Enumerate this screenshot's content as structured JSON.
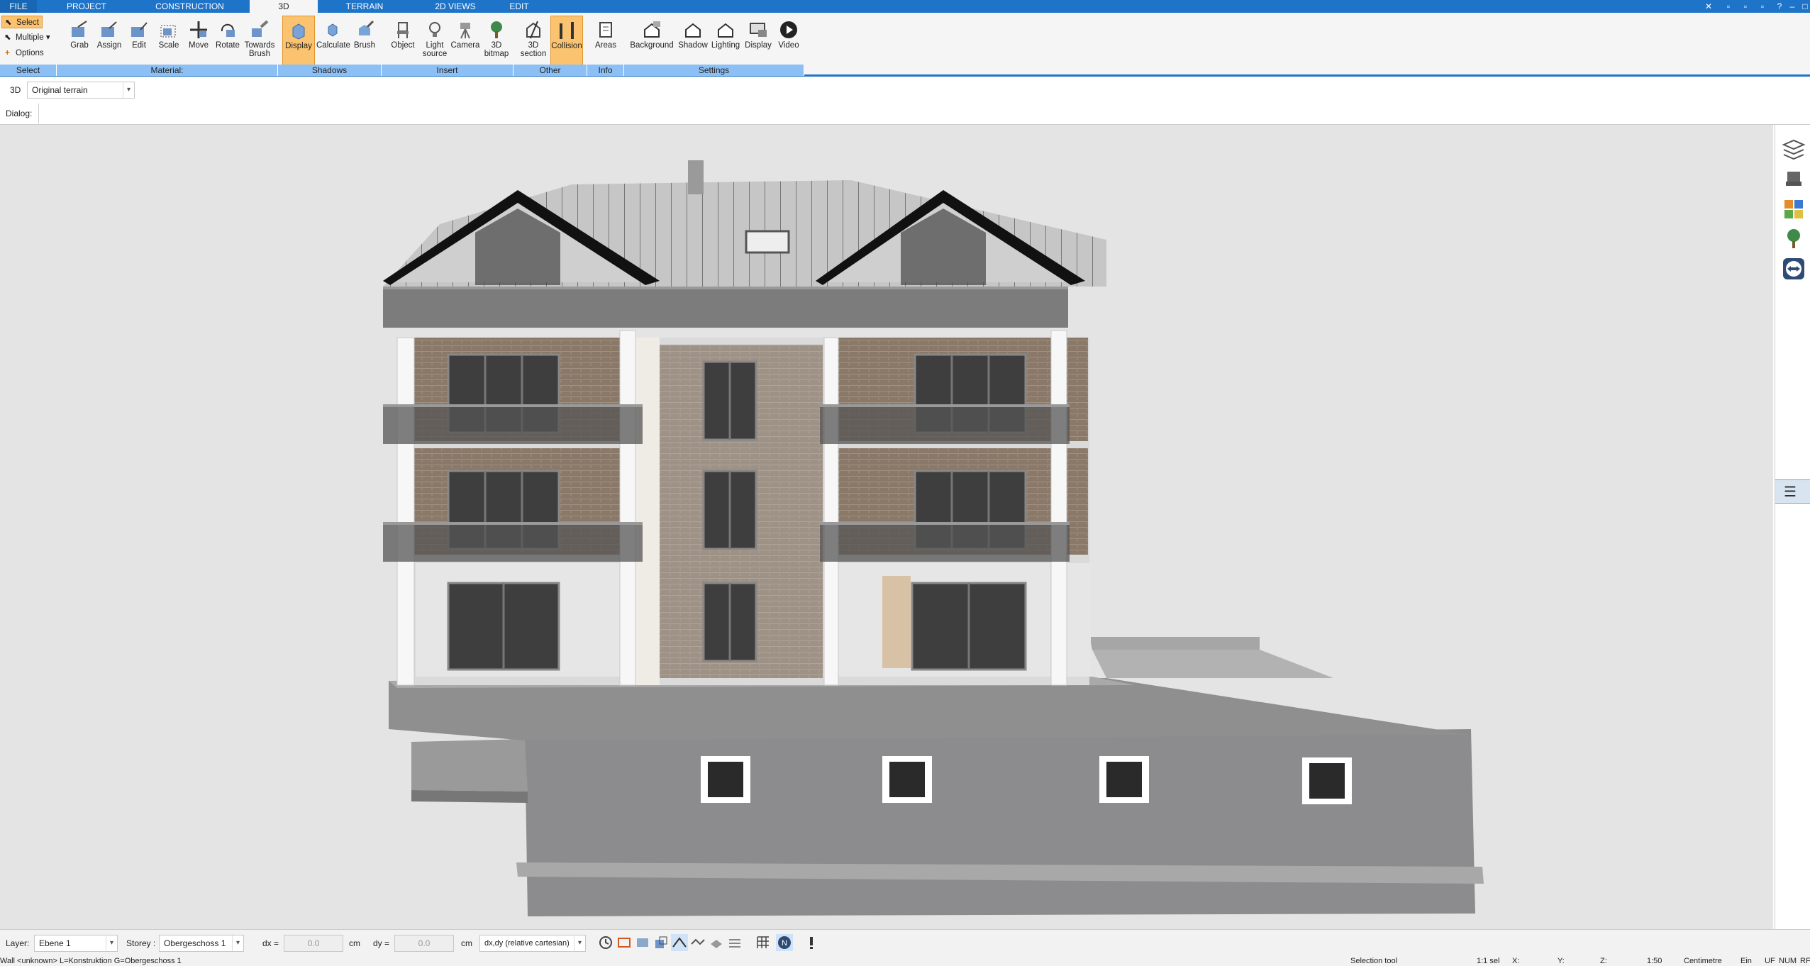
{
  "tabs": [
    "FILE",
    "PROJECT",
    "CONSTRUCTION",
    "3D",
    "TERRAIN",
    "2D VIEWS",
    "EDIT"
  ],
  "ribbon": {
    "select": {
      "select": "Select",
      "multiple": "Multiple",
      "options": "Options"
    },
    "buttons": [
      "Grab",
      "Assign",
      "Edit",
      "Scale",
      "Move",
      "Rotate",
      "Towards Brush",
      "Display",
      "Calculate",
      "Brush",
      "Object",
      "Light source",
      "Camera",
      "3D bitmap",
      "3D section",
      "Collision",
      "Areas",
      "Background",
      "Shadow",
      "Lighting",
      "Display",
      "Video"
    ],
    "groups": [
      "Select",
      "Material:",
      "Shadows",
      "Insert",
      "Other",
      "Info",
      "Settings"
    ]
  },
  "view": {
    "mode": "3D",
    "terrain": "Original terrain"
  },
  "dialog": {
    "label": "Dialog:"
  },
  "status": {
    "layer_label": "Layer:",
    "layer": "Ebene 1",
    "storey_label": "Storey :",
    "storey": "Obergeschoss 1",
    "dx_label": "dx =",
    "dx": "0.0",
    "dx_unit": "cm",
    "dy_label": "dy =",
    "dy": "0.0",
    "dy_unit": "cm",
    "coord_mode": "dx,dy (relative cartesian)"
  },
  "infoline": {
    "left": "Wall <unknown> L=Konstruktion G=Obergeschoss 1",
    "tool": "Selection tool",
    "sel": "1:1 sel",
    "x": "X:",
    "y": "Y:",
    "z": "Z:",
    "scale": "1:50",
    "unit": "Centimetre",
    "ein": "Ein",
    "uf": "UF",
    "num": "NUM",
    "rf": "RF"
  },
  "colors": {
    "accent": "#1e74c9",
    "active": "#fbc36f",
    "group_bar": "#8cc0f5",
    "viewport": "#e4e4e4"
  }
}
